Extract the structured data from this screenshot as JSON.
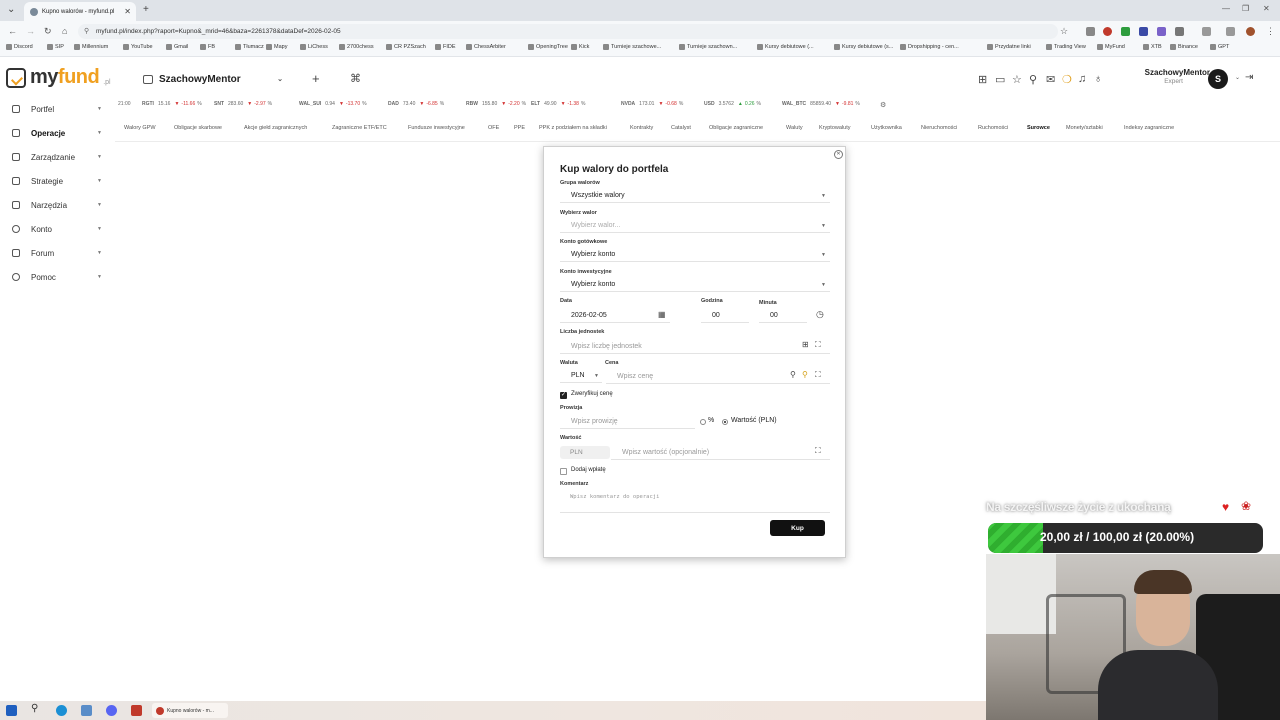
{
  "browser": {
    "tab_title": "Kupno walorów - myfund.pl",
    "url": "myfund.pl/index.php?raport=Kupno&_mrid=46&baza=2261378&dataDef=2026-02-05",
    "bookmarks": [
      "Discord",
      "SIP",
      "Millennium",
      "YouTube",
      "Gmail",
      "FB",
      "Tłumacz",
      "Mapy",
      "LiChess",
      "2700chess",
      "CR PZSzach",
      "FIDE",
      "ChessArbiter",
      "OpeningTree",
      "Kick",
      "Turnieje szachowe...",
      "Turnieje szachown...",
      "Kursy debiutowe (...",
      "Kursy debiutowe (s...",
      "Dropshipping - cen...",
      "Przydatne linki",
      "Trading View",
      "MyFund",
      "XTB",
      "Binance",
      "GPT"
    ]
  },
  "header": {
    "logo_my": "my",
    "logo_fund": "fund",
    "logo_pl": ".pl",
    "portfolio": "SzachowyMentor",
    "add_symbol": "+",
    "cmd_symbol": "⌘",
    "user_name": "SzachowyMentor",
    "user_role": "Expert",
    "avatar_letter": "S"
  },
  "sidebar": {
    "items": [
      {
        "label": "Portfel"
      },
      {
        "label": "Operacje"
      },
      {
        "label": "Zarządzanie"
      },
      {
        "label": "Strategie"
      },
      {
        "label": "Narzędzia"
      },
      {
        "label": "Konto"
      },
      {
        "label": "Forum"
      },
      {
        "label": "Pomoc"
      }
    ]
  },
  "ticker": {
    "time": "21:00",
    "items": [
      {
        "symbol": "RGTI",
        "value": "15.16",
        "change": "-11.66",
        "dir": "down"
      },
      {
        "symbol": "SNT",
        "value": "283.60",
        "change": "-2.97",
        "dir": "down"
      },
      {
        "symbol": "WAL_SUI",
        "value": "0.94",
        "change": "-13.70",
        "dir": "down"
      },
      {
        "symbol": "DAD",
        "value": "73.40",
        "change": "-6.85",
        "dir": "down"
      },
      {
        "symbol": "RBW",
        "value": "155.80",
        "change": "-2.20",
        "dir": "down"
      },
      {
        "symbol": "ELT",
        "value": "49.90",
        "change": "-1.38",
        "dir": "down"
      },
      {
        "symbol": "NVDA",
        "value": "173.01",
        "change": "-0.68",
        "dir": "down"
      },
      {
        "symbol": "USD",
        "value": "3.5762",
        "change": "0.26",
        "dir": "up"
      },
      {
        "symbol": "WAL_BTC",
        "value": "85859.40",
        "change": "-9.81",
        "dir": "down"
      }
    ]
  },
  "categories": [
    "Walory GPW",
    "Obligacje skarbowe",
    "Akcje giełd zagranicznych",
    "Zagraniczne ETF/ETC",
    "Fundusze inwestycyjne",
    "OFE",
    "PPE",
    "PPK z podziałem na składki",
    "Kontrakty",
    "Catalyst",
    "Obligacje zagraniczne",
    "Waluty",
    "Kryptowaluty",
    "Użytkownika",
    "Nieruchomości",
    "Ruchomości",
    "Surowce",
    "Monety/sztabki",
    "Indeksy zagraniczne"
  ],
  "active_category": "Surowce",
  "modal": {
    "title": "Kup walory do portfela",
    "asset_group_label": "Grupa walorów",
    "asset_group_value": "Wszystkie walory",
    "asset_label": "Wybierz walor",
    "asset_placeholder": "Wybierz walor...",
    "cash_account_label": "Konto gotówkowe",
    "cash_account_value": "Wybierz konto",
    "invest_account_label": "Konto inwestycyjne",
    "invest_account_value": "Wybierz konto",
    "date_label": "Data",
    "date_value": "2026-02-05",
    "hour_label": "Godzina",
    "hour_value": "00",
    "minute_label": "Minuta",
    "minute_value": "00",
    "units_label": "Liczba jednostek",
    "units_placeholder": "Wpisz liczbę jednostek",
    "currency_label": "Waluta",
    "currency_value": "PLN",
    "price_label": "Cena",
    "price_placeholder": "Wpisz cenę",
    "verify_label": "Zweryfikuj cenę",
    "verify_checked": true,
    "commission_label": "Prowizja",
    "commission_placeholder": "Wpisz prowizję",
    "percent_option": "%",
    "value_option": "Wartość (PLN)",
    "value_label": "Wartość",
    "value_currency": "PLN",
    "value_placeholder": "Wpisz wartość (opcjonalnie)",
    "add_deposit_label": "Dodaj wpłatę",
    "comment_label": "Komentarz",
    "comment_placeholder": "Wpisz komentarz do operacji",
    "buy_button": "Kup"
  },
  "stream_overlay": {
    "goal_text": "Na szczęśliwsze życie z ukochaną",
    "goal_progress_label": "20,00 zł / 100,00 zł (20.00%)",
    "goal_progress_fraction": 0.2,
    "fill_color": "#3ec83e"
  },
  "taskbar": {
    "active_task": "Kupno walorów - m..."
  }
}
